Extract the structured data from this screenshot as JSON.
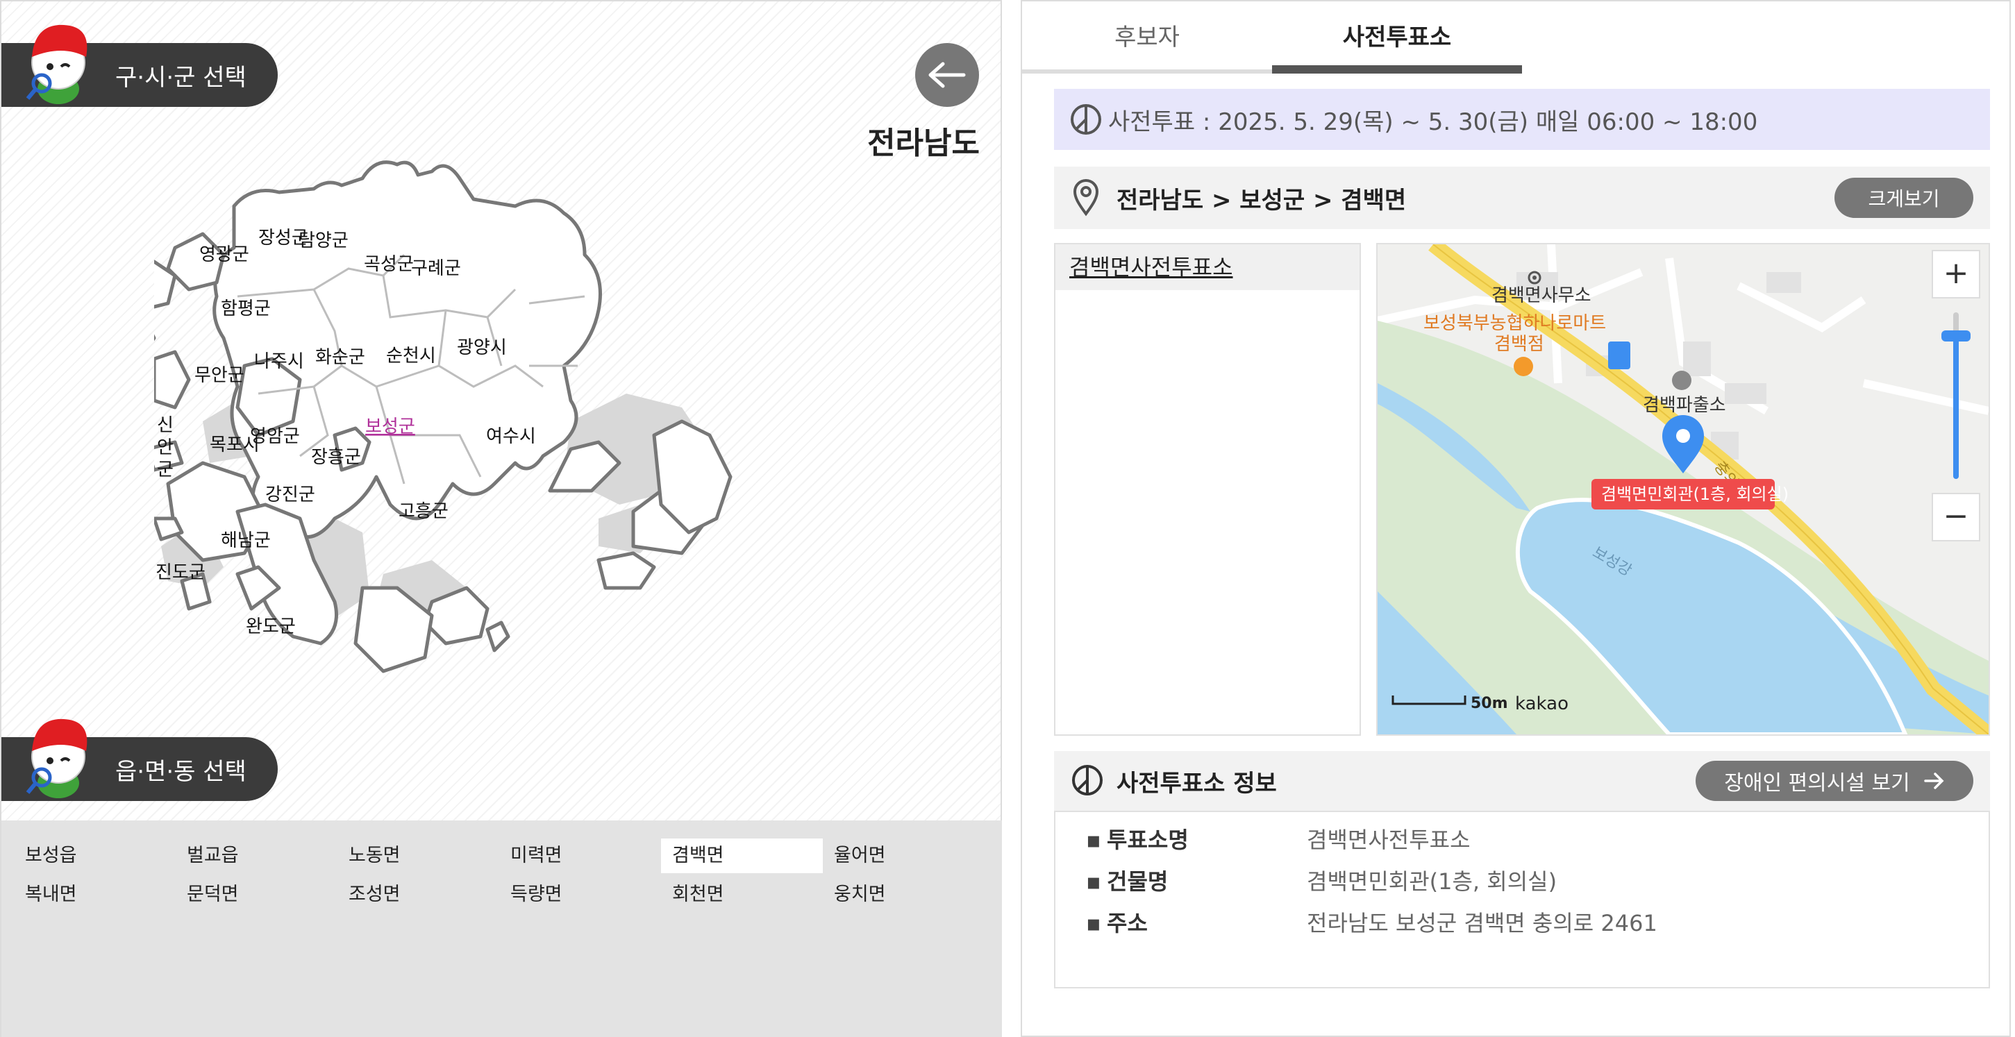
{
  "left_panel": {
    "district_select_label": "구·시·군 선택",
    "town_select_label": "읍·면·동 선택",
    "region_title": "전라남도",
    "map_labels": {
      "yeonggwang": "영광군",
      "jangseong": "장성군",
      "damyang": "담양군",
      "gokseong": "곡성군",
      "gurye": "구례군",
      "hampyeong": "함평군",
      "naju": "나주시",
      "hwasun": "화순군",
      "suncheon": "순천시",
      "gwangyang": "광양시",
      "muan": "무안군",
      "sinan": "신\n안\n군",
      "mokpo": "목포시",
      "yeongam": "영암군",
      "jangheung": "장흥군",
      "boseong": "보성군",
      "yeosu": "여수시",
      "gangjin": "강진군",
      "goheung": "고흥군",
      "haenam": "해남군",
      "jindo": "진도군",
      "wando": "완도군"
    },
    "towns": [
      "보성읍",
      "벌교읍",
      "노동면",
      "미력면",
      "겸백면",
      "율어면",
      "복내면",
      "문덕면",
      "조성면",
      "득량면",
      "회천면",
      "웅치면"
    ],
    "selected_town": "겸백면"
  },
  "right_panel": {
    "tabs": {
      "candidates": "후보자",
      "early_voting": "사전투표소"
    },
    "early_vote_notice": "사전투표 : 2025. 5. 29(목) ~ 5. 30(금) 매일 06:00 ~ 18:00",
    "location_path": "전라남도 > 보성군 > 겸백면",
    "enlarge_label": "크게보기",
    "place_name": "겸백면사전투표소",
    "map_labels": {
      "office": "겸백면사무소",
      "mart_line1": "보성북부농협하나로마트",
      "mart_line2": "겸백점",
      "police": "겸백파출소",
      "road": "충의로",
      "river": "보성강",
      "marker": "겸백면민회관(1층, 회의실)",
      "scale": "50m",
      "brand": "kakao"
    },
    "zoom_in": "+",
    "zoom_out": "−",
    "info_title": "사전투표소 정보",
    "accessibility_label": "장애인 편의시설 보기",
    "info_rows": [
      {
        "key": "투표소명",
        "value": "겸백면사전투표소"
      },
      {
        "key": "건물명",
        "value": "겸백면민회관(1층, 회의실)"
      },
      {
        "key": "주소",
        "value": "전라남도 보성군 겸백면 충의로 2461"
      }
    ],
    "colors": {
      "accent_blue": "#3d8ef0",
      "marker_red": "#ef4b4b",
      "road_yellow": "#f6d95f",
      "river_blue": "#a9d6f2"
    }
  }
}
